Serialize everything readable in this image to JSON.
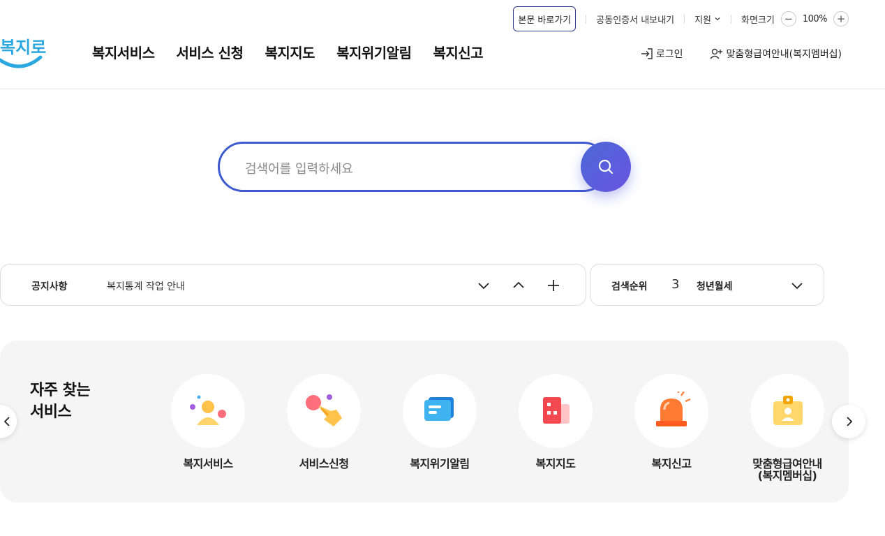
{
  "utility": {
    "skip_link": "본문 바로가기",
    "cert_export": "공동인증서 내보내기",
    "support": "지원",
    "screen_size_label": "화면크기",
    "zoom_out": "−",
    "zoom_value": "100%",
    "zoom_in": "+"
  },
  "logo": {
    "text": "복지로",
    "color": "#2ba8e0"
  },
  "nav": {
    "items": [
      "복지서비스",
      "서비스 신청",
      "복지지도",
      "복지위기알림",
      "복지신고"
    ]
  },
  "member": {
    "login": "로그인",
    "membership": "맞춤형급여안내(복지멤버십)"
  },
  "search": {
    "placeholder": "검색어를 입력하세요",
    "value": "",
    "accent": "#3f5bd0"
  },
  "notice": {
    "label": "공지사항",
    "text": "복지통계 작업 안내"
  },
  "ranking": {
    "label": "검색순위",
    "number": "3",
    "term": "청년월세"
  },
  "frequent": {
    "title": "자주 찾는\n서비스",
    "items": [
      {
        "label": "복지서비스",
        "icon": "person-icon"
      },
      {
        "label": "서비스신청",
        "icon": "hand-pointer-icon"
      },
      {
        "label": "복지위기알림",
        "icon": "message-icon"
      },
      {
        "label": "복지지도",
        "icon": "building-icon"
      },
      {
        "label": "복지신고",
        "icon": "siren-icon"
      },
      {
        "label": "맞춤형급여안내\n(복지멤버십)",
        "icon": "id-card-icon"
      }
    ]
  }
}
